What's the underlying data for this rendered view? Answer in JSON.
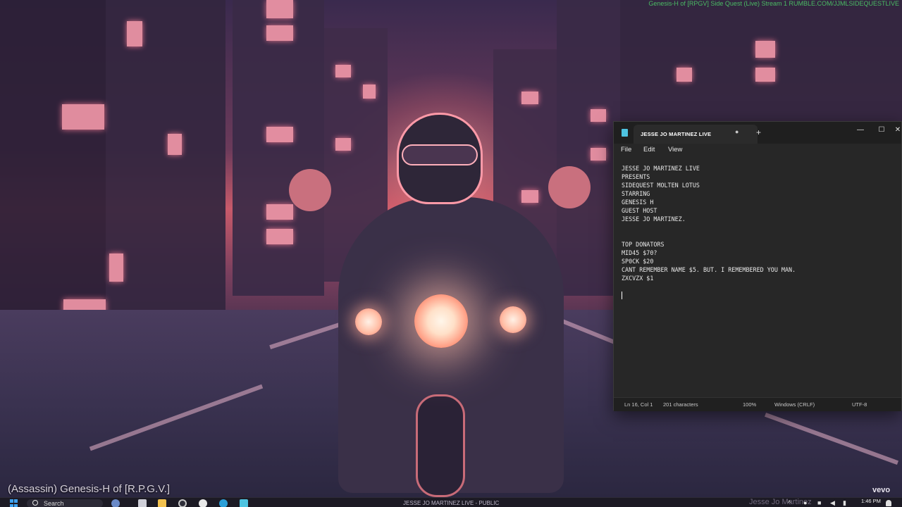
{
  "desktop": {
    "top_watermark": "Genesis-H of [RPGV] Side Quest (Live) Stream 1 RUMBLE.COM/JJMLSIDEQUESTLIVE",
    "overlay_name": "(Assassin) Genesis-H of [R.P.G.V.]",
    "vevo_label": "vevo",
    "ghost_text": "Jesse Jo Martinez"
  },
  "notepad": {
    "tab_title": "JESSE JO MARTINEZ LIVE",
    "tab_close": "●",
    "new_tab": "+",
    "window_buttons": {
      "minimize": "—",
      "maximize": "☐",
      "close": "✕"
    },
    "menu": {
      "file": "File",
      "edit": "Edit",
      "view": "View"
    },
    "lines": [
      "JESSE JO MARTINEZ LIVE",
      "PRESENTS",
      "SIDEQUEST MOLTEN LOTUS",
      "STARRING",
      "GENESIS H",
      "GUEST HOST",
      "JESSE JO MARTINEZ.",
      "",
      "",
      "TOP DONATORS",
      "MID45 $70?",
      "SP0CK $20",
      "CANT REMEMBER NAME $5. BUT. I REMEMBERED YOU MAN.",
      "ZXCVZX $1",
      "",
      ""
    ],
    "status": {
      "position": "Ln 16, Col 1",
      "characters": "201 characters",
      "zoom": "100%",
      "line_endings": "Windows (CRLF)",
      "encoding": "UTF-8"
    }
  },
  "taskbar": {
    "search_label": "Search",
    "center_title": "JESSE JO MARTINEZ LIVE - PUBLIC",
    "time": "1:46 PM",
    "icons": [
      "widgets-icon",
      "task-view-icon",
      "file-explorer-icon",
      "chrome-icon",
      "media-player-icon",
      "edge-icon",
      "notepad-icon"
    ]
  },
  "colors": {
    "notepad_bg": "#272727",
    "titlebar_bg": "#1f1f1f",
    "accent": "#4ec3e0",
    "watermark": "#4fd36a"
  }
}
